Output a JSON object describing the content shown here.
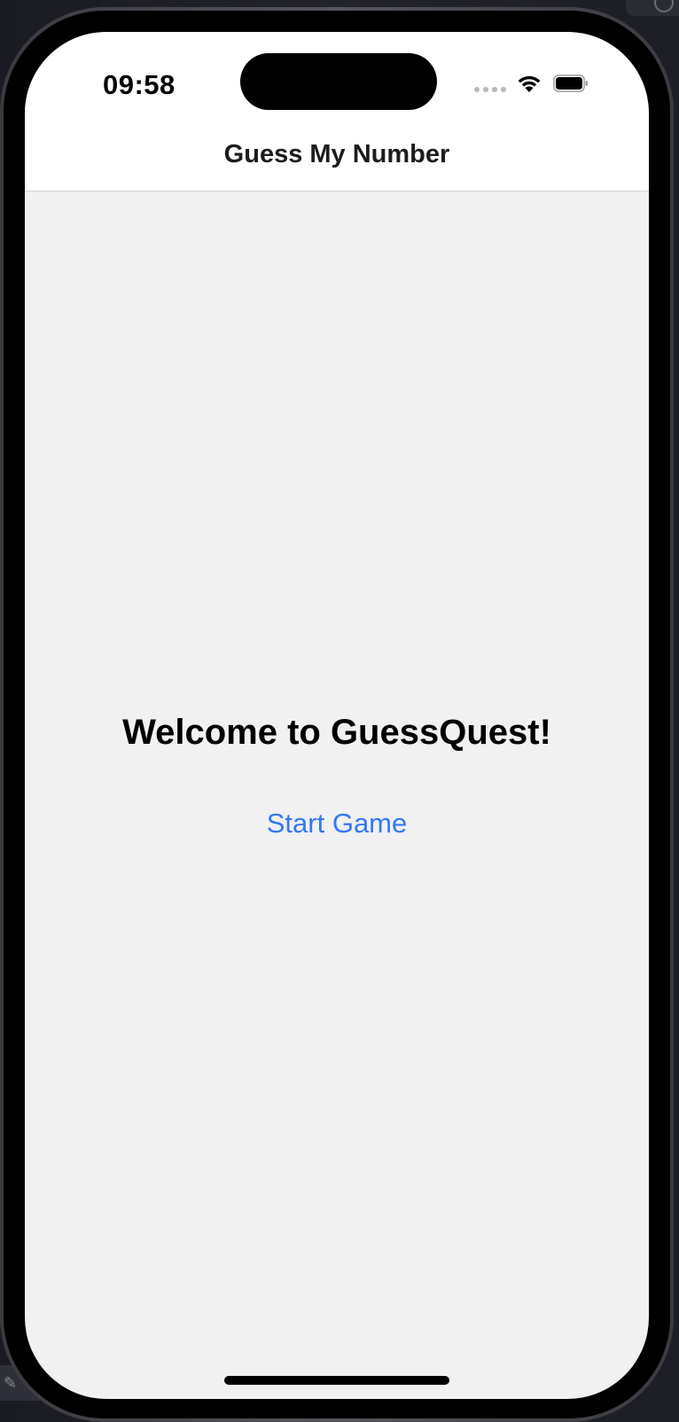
{
  "status_bar": {
    "time": "09:58",
    "signal_icon": "signal-dots-icon",
    "wifi_icon": "wifi-icon",
    "battery_icon": "battery-full-icon"
  },
  "nav": {
    "title": "Guess My Number"
  },
  "main": {
    "welcome_text": "Welcome to GuessQuest!",
    "start_button_label": "Start Game"
  },
  "colors": {
    "accent": "#3478f6",
    "background": "#f1f1f2",
    "nav_background": "#ffffff"
  }
}
